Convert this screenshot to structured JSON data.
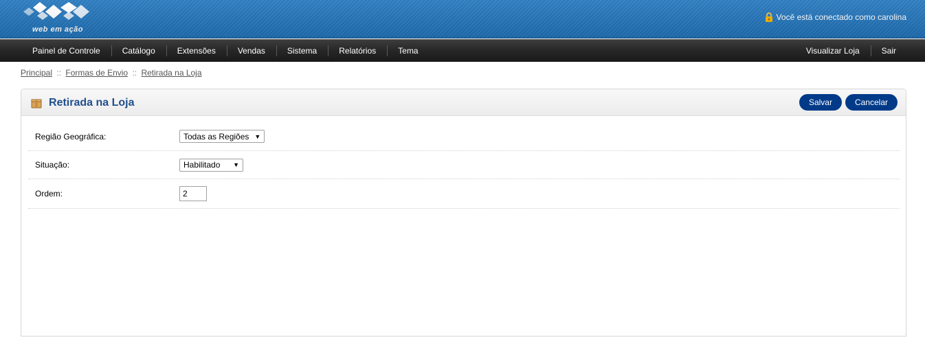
{
  "header": {
    "logo_text": "web em ação",
    "user_text": "Você está conectado como carolina"
  },
  "menu": {
    "left": [
      "Painel de Controle",
      "Catálogo",
      "Extensões",
      "Vendas",
      "Sistema",
      "Relatórios",
      "Tema"
    ],
    "right": [
      "Visualizar Loja",
      "Sair"
    ]
  },
  "breadcrumb": {
    "items": [
      "Principal",
      "Formas de Envio",
      "Retirada na Loja"
    ],
    "separator": "::"
  },
  "box": {
    "title": "Retirada na Loja",
    "icon": "package-icon",
    "save_label": "Salvar",
    "cancel_label": "Cancelar"
  },
  "form": {
    "geo_zone_label": "Região Geográfica:",
    "geo_zone_value": "Todas as Regiões",
    "status_label": "Situação:",
    "status_value": "Habilitado",
    "sort_order_label": "Ordem:",
    "sort_order_value": "2"
  },
  "colors": {
    "header_blue": "#1f6fb5",
    "button_blue": "#003a88",
    "title_blue": "#1f4f8c",
    "menu_dark": "#262626"
  }
}
